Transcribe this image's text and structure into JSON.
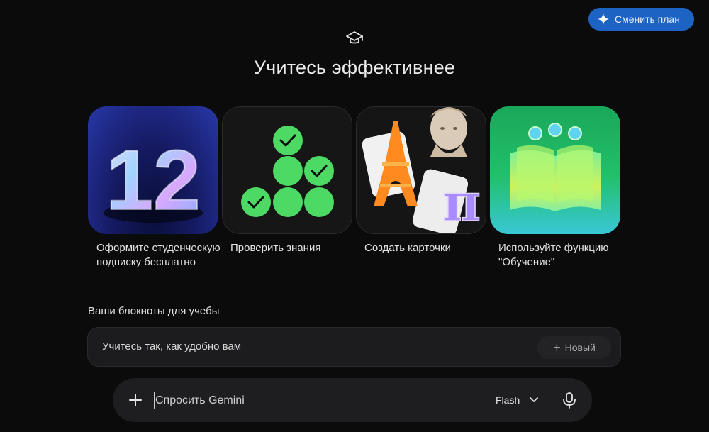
{
  "header": {
    "upgrade_label": "Сменить план"
  },
  "page": {
    "title": "Учитесь эффективнее"
  },
  "cards": [
    {
      "label": "Оформите студенческую подписку бесплатно",
      "art_text": "12"
    },
    {
      "label": "Проверить знания"
    },
    {
      "label": "Создать карточки",
      "art_text": "π"
    },
    {
      "label": "Используйте функцию \"Обучение\""
    }
  ],
  "notebooks": {
    "section_title": "Ваши блокноты для учебы",
    "item_text": "Учитесь так, как удобно вам",
    "new_label": "Новый"
  },
  "prompt": {
    "placeholder": "Спросить Gemini",
    "model": "Flash"
  },
  "colors": {
    "accent": "#1d63c4",
    "check_green": "#4cd964"
  }
}
